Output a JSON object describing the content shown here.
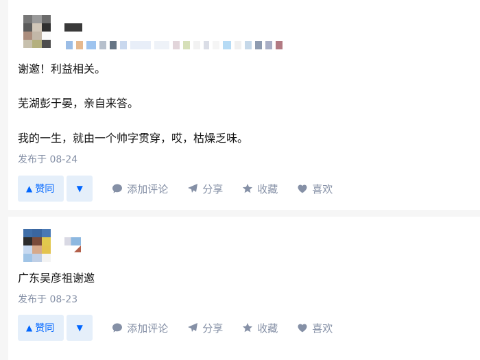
{
  "posts": [
    {
      "body": [
        "谢邀！利益相关。",
        "芜湖彭于晏，亲自来答。",
        "我的一生，就由一个帅字贯穿，哎，枯燥乏味。"
      ],
      "time": "发布于 08-24"
    },
    {
      "body": [
        "广东吴彦祖谢邀"
      ],
      "time": "发布于 08-23"
    }
  ],
  "actions": {
    "upvote": "赞同",
    "comment": "添加评论",
    "share": "分享",
    "favorite": "收藏",
    "like": "喜欢"
  },
  "colors": {
    "accent": "#0066ff",
    "vote_bg": "#e5effa",
    "muted": "#8590a6",
    "text": "#121212"
  },
  "icons": [
    "caret-up-icon",
    "caret-down-icon",
    "comment-icon",
    "share-icon",
    "star-icon",
    "heart-icon"
  ]
}
